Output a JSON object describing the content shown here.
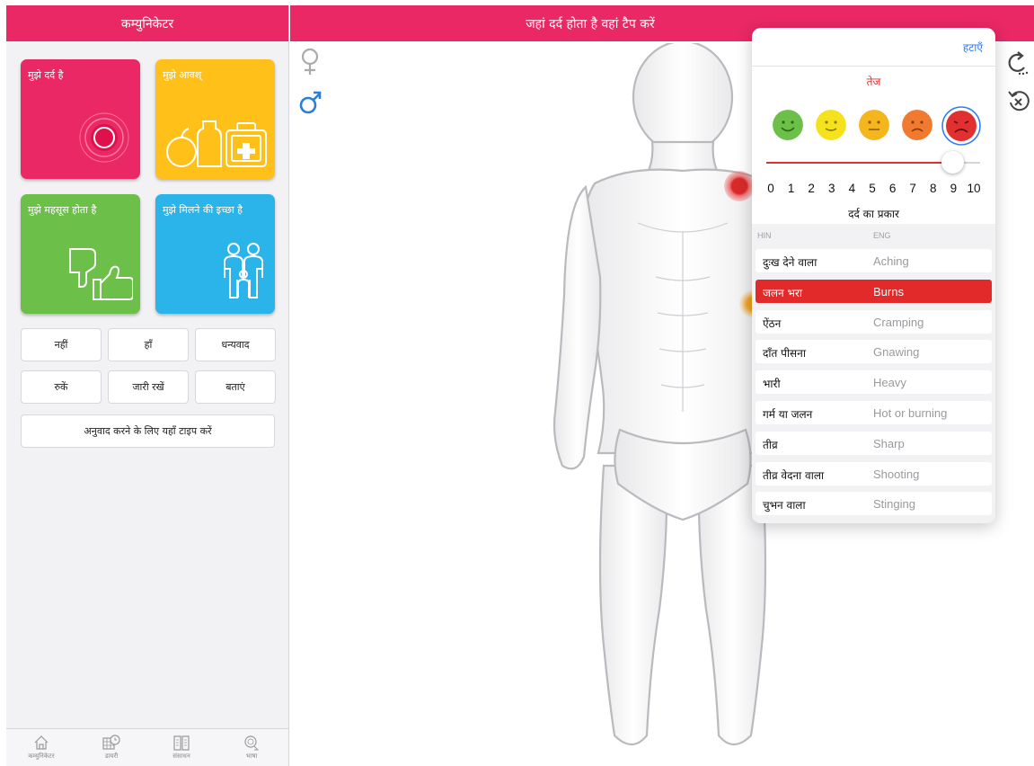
{
  "communicator": {
    "title": "कम्युनिकेटर",
    "tiles": {
      "pain": "मुझे दर्द है",
      "need": "मुझे आवश्",
      "feel": "मुझे महसूस होता है",
      "meet": "मुझे मिलने की इच्छा है"
    },
    "quick_buttons": [
      "नहीं",
      "हाँ",
      "धन्यवाद",
      "रुकें",
      "जारी रखें",
      "बताएं"
    ],
    "type_prompt": "अनुवाद करने के लिए यहाँ  टाइप करें",
    "nav": [
      "कम्युनिकेटर",
      "डायरी",
      "संसाधन",
      "भाषा"
    ]
  },
  "main": {
    "title": "जहां दर्द होता है वहां टैप करें"
  },
  "popover": {
    "remove_label": "हटाएँ",
    "intensity_label": "तेज",
    "pain_level": 9,
    "scale": [
      "0",
      "1",
      "2",
      "3",
      "4",
      "5",
      "6",
      "7",
      "8",
      "9",
      "10"
    ],
    "faces": [
      {
        "name": "very-happy-face-icon",
        "color": "#6cc049"
      },
      {
        "name": "happy-face-icon",
        "color": "#f5e21d"
      },
      {
        "name": "neutral-face-icon",
        "color": "#f5b51d"
      },
      {
        "name": "sad-face-icon",
        "color": "#f07a30"
      },
      {
        "name": "crying-face-icon",
        "color": "#e03030"
      }
    ],
    "selected_face": 4,
    "type_title": "दर्द का प्रकार",
    "col_hin": "HIN",
    "col_eng": "ENG",
    "pain_types": [
      {
        "hin": "दुःख देने वाला",
        "eng": "Aching"
      },
      {
        "hin": "जलन भरा",
        "eng": "Burns"
      },
      {
        "hin": "ऐंठन",
        "eng": "Cramping"
      },
      {
        "hin": "दाँत पीसना",
        "eng": "Gnawing"
      },
      {
        "hin": "भारी",
        "eng": "Heavy"
      },
      {
        "hin": "गर्म या जलन",
        "eng": "Hot or burning"
      },
      {
        "hin": "तीव्र",
        "eng": "Sharp"
      },
      {
        "hin": "तीव्र वेदना वाला",
        "eng": "Shooting"
      },
      {
        "hin": "चुभन वाला",
        "eng": "Stinging"
      }
    ],
    "selected_type": 1
  },
  "colors": {
    "brand_pink": "#ea2866",
    "tile_yellow": "#ffc119",
    "tile_green": "#6cc049",
    "tile_blue": "#2ab4ea",
    "selection_red": "#e22a2a",
    "link_blue": "#2f7cf6"
  },
  "icons": {
    "female": "female-symbol-icon",
    "male": "male-symbol-icon",
    "refresh": "refresh-icon",
    "reset": "reset-icon"
  }
}
